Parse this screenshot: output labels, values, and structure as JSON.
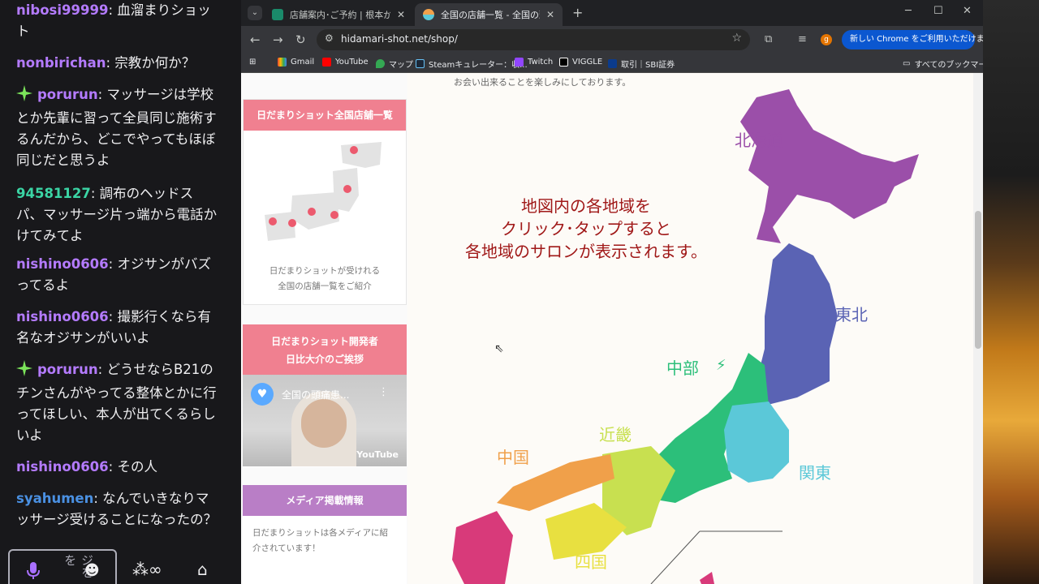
{
  "chat": {
    "messages": [
      {
        "user": "nibosi99999",
        "text": "血溜まりショット",
        "color": "#b47bff",
        "badge": false
      },
      {
        "user": "nonbirichan",
        "text": "宗教か何か？",
        "color": "#b47bff",
        "badge": false
      },
      {
        "user": "porurun",
        "text": "マッサージは学校とか先輩に習って全員同じ施術するんだから、どこでやってもほぼ同じだと思うよ",
        "color": "#b47bff",
        "badge": true
      },
      {
        "user": "94581127",
        "text": "調布のヘッドスパ、マッサージ片っ端から電話かけてみてよ",
        "color": "#3bd5a5",
        "badge": false
      },
      {
        "user": "nishino0606",
        "text": "オジサンがバズってるよ",
        "color": "#b47bff",
        "badge": false
      },
      {
        "user": "nishino0606",
        "text": "撮影行くなら有名なオジサンがいいよ",
        "color": "#b47bff",
        "badge": false
      },
      {
        "user": "porurun",
        "text": "どうせならB21のチンさんがやってる整体とかに行ってほしい、本人が出てくるらしいよ",
        "color": "#b47bff",
        "badge": true
      },
      {
        "user": "nishino0606",
        "text": "その人",
        "color": "#b47bff",
        "badge": false
      },
      {
        "user": "syahumen",
        "text": "なんでいきなりマッサージ受けることになったの？",
        "color": "#4a90e2",
        "badge": false
      }
    ],
    "input_placeholder": "ジをを"
  },
  "browser": {
    "tabs": [
      {
        "label": "店舗案内･ご予約 | 根本からアプロ",
        "active": false
      },
      {
        "label": "全国の店舗一覧 - 全国の頭痛セ",
        "active": true
      }
    ],
    "url": "hidamari-shot.net/shop/",
    "profile_initial": "g",
    "promo": "新しい Chrome をご利用いただけます",
    "bookmarks": [
      "Gmail",
      "YouTube",
      "マップ",
      "Steamキュレーター：収...",
      "Twitch",
      "VIGGLE",
      "取引｜SBI証券"
    ],
    "all_bookmarks": "すべてのブックマーク"
  },
  "page": {
    "greeting": "お会い出来ることを楽しみにしております。",
    "sidebar": {
      "shop_list_title": "日だまりショット全国店舗一覧",
      "shop_list_desc": [
        "日だまりショットが受けれる",
        "全国の店舗一覧をご紹介"
      ],
      "developer_title": [
        "日だまりショット開発者",
        "日比大介のご挨拶"
      ],
      "video_title": "全国の頭痛患...",
      "video_brand": "YouTube",
      "media_title": "メディア掲載情報",
      "media_desc": [
        "日だまりショットは各メディアに紹",
        "介されています！"
      ]
    },
    "map": {
      "instruction": [
        "地図内の各地域を",
        "クリック･タップすると",
        "各地域のサロンが表示されます。"
      ],
      "regions": [
        "北海道",
        "東北",
        "中部",
        "関東",
        "近畿",
        "中国",
        "四国"
      ],
      "region_colors": {
        "北海道": "#9b4fa9",
        "東北": "#5a63b4",
        "中部": "#2cbf7a",
        "関東": "#5bc8d8",
        "近畿": "#c8e050",
        "中国": "#f0a04a",
        "四国": "#e8e040",
        "九州": "#d83a7a"
      }
    }
  }
}
